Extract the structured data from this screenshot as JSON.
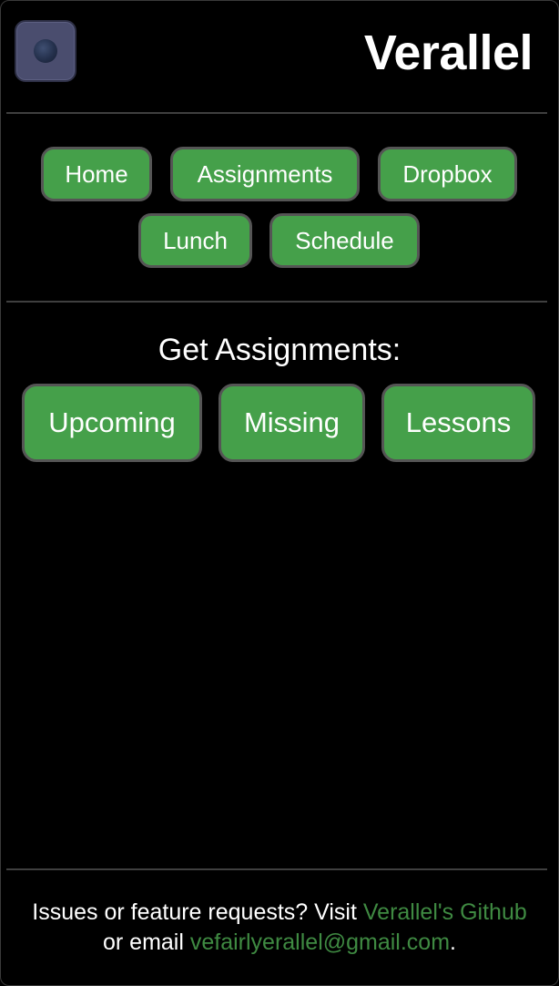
{
  "brand": {
    "title": "Verallel"
  },
  "nav": {
    "items": [
      {
        "label": "Home"
      },
      {
        "label": "Assignments"
      },
      {
        "label": "Dropbox"
      },
      {
        "label": "Lunch"
      },
      {
        "label": "Schedule"
      }
    ]
  },
  "assignments": {
    "heading": "Get Assignments:",
    "buttons": [
      {
        "label": "Upcoming"
      },
      {
        "label": "Missing"
      },
      {
        "label": "Lessons"
      }
    ]
  },
  "footer": {
    "text_before": "Issues or feature requests? Visit ",
    "github_link": "Verallel's Github",
    "text_middle": " or email ",
    "email_link": "vefairlyerallel@gmail.com",
    "text_after": "."
  },
  "colors": {
    "background": "#000000",
    "button_green": "#45a04a",
    "link_green": "#3f8a42",
    "divider": "#3f3f3f"
  }
}
